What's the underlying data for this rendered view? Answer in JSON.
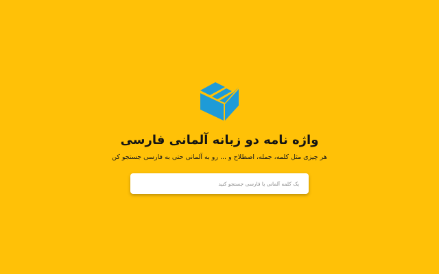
{
  "app": {
    "title": "واژه نامه دو زبانه آلمانی فارسی",
    "subtitle": "هر چیزی مثل کلمه، جمله، اصطلاح و ... رو به آلمانی حتی به فارسی جستجو کن"
  },
  "search": {
    "placeholder": "یک کلمه آلمانی یا فارسی جستجو کنید",
    "value": ""
  },
  "colors": {
    "background": "#FFC107",
    "logo": "#1E9BD7"
  },
  "icons": {
    "logo": "box-logo-icon"
  }
}
